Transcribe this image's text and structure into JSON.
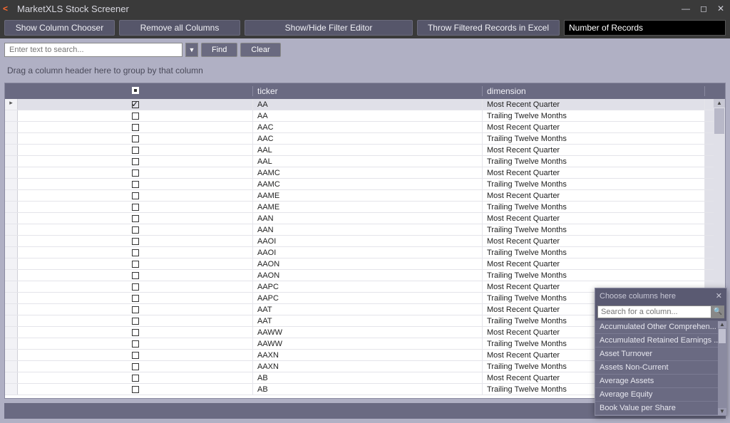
{
  "window": {
    "title": "MarketXLS Stock Screener"
  },
  "toolbar": {
    "show_column_chooser": "Show Column Chooser",
    "remove_all_columns": "Remove all Columns",
    "show_hide_filter": "Show/Hide Filter Editor",
    "throw_filtered": "Throw Filtered Records in Excel",
    "number_of_records": "Number of Records"
  },
  "search": {
    "placeholder": "Enter text to search...",
    "find": "Find",
    "clear": "Clear"
  },
  "group_hint": "Drag a column header here to group by that column",
  "columns": {
    "ticker": "ticker",
    "dimension": "dimension"
  },
  "rows": [
    {
      "checked": true,
      "ticker": "AA",
      "dimension": "Most Recent Quarter",
      "selected": true
    },
    {
      "checked": false,
      "ticker": "AA",
      "dimension": "Trailing Twelve Months"
    },
    {
      "checked": false,
      "ticker": "AAC",
      "dimension": "Most Recent Quarter"
    },
    {
      "checked": false,
      "ticker": "AAC",
      "dimension": "Trailing Twelve Months"
    },
    {
      "checked": false,
      "ticker": "AAL",
      "dimension": "Most Recent Quarter"
    },
    {
      "checked": false,
      "ticker": "AAL",
      "dimension": "Trailing Twelve Months"
    },
    {
      "checked": false,
      "ticker": "AAMC",
      "dimension": "Most Recent Quarter"
    },
    {
      "checked": false,
      "ticker": "AAMC",
      "dimension": "Trailing Twelve Months"
    },
    {
      "checked": false,
      "ticker": "AAME",
      "dimension": "Most Recent Quarter"
    },
    {
      "checked": false,
      "ticker": "AAME",
      "dimension": "Trailing Twelve Months"
    },
    {
      "checked": false,
      "ticker": "AAN",
      "dimension": "Most Recent Quarter"
    },
    {
      "checked": false,
      "ticker": "AAN",
      "dimension": "Trailing Twelve Months"
    },
    {
      "checked": false,
      "ticker": "AAOI",
      "dimension": "Most Recent Quarter"
    },
    {
      "checked": false,
      "ticker": "AAOI",
      "dimension": "Trailing Twelve Months"
    },
    {
      "checked": false,
      "ticker": "AAON",
      "dimension": "Most Recent Quarter"
    },
    {
      "checked": false,
      "ticker": "AAON",
      "dimension": "Trailing Twelve Months"
    },
    {
      "checked": false,
      "ticker": "AAPC",
      "dimension": "Most Recent Quarter"
    },
    {
      "checked": false,
      "ticker": "AAPC",
      "dimension": "Trailing Twelve Months"
    },
    {
      "checked": false,
      "ticker": "AAT",
      "dimension": "Most Recent Quarter"
    },
    {
      "checked": false,
      "ticker": "AAT",
      "dimension": "Trailing Twelve Months"
    },
    {
      "checked": false,
      "ticker": "AAWW",
      "dimension": "Most Recent Quarter"
    },
    {
      "checked": false,
      "ticker": "AAWW",
      "dimension": "Trailing Twelve Months"
    },
    {
      "checked": false,
      "ticker": "AAXN",
      "dimension": "Most Recent Quarter"
    },
    {
      "checked": false,
      "ticker": "AAXN",
      "dimension": "Trailing Twelve Months"
    },
    {
      "checked": false,
      "ticker": "AB",
      "dimension": "Most Recent Quarter"
    },
    {
      "checked": false,
      "ticker": "AB",
      "dimension": "Trailing Twelve Months"
    }
  ],
  "column_chooser": {
    "title": "Choose columns here",
    "search_placeholder": "Search for a column...",
    "items": [
      "Accumulated Other Comprehen...",
      "Accumulated Retained Earnings ...",
      "Asset Turnover",
      "Assets Non-Current",
      "Average Assets",
      "Average Equity",
      "Book Value per Share"
    ]
  }
}
